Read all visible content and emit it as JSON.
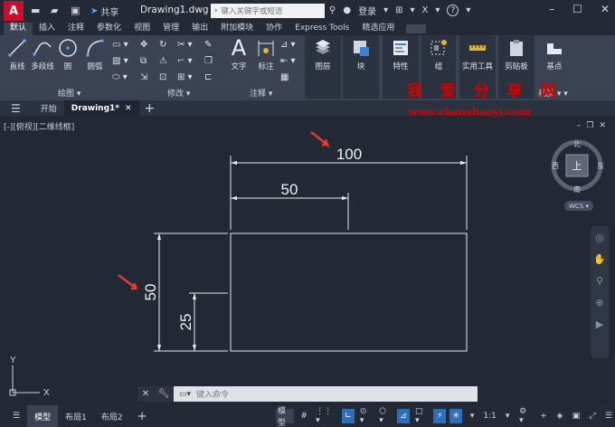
{
  "titlebar": {
    "logo": "A",
    "share_label": "共享",
    "doc_title": "Drawing1.dwg",
    "search_placeholder": "键入关键字或短语",
    "login_label": "登录",
    "help": "?"
  },
  "ribbon_tabs": [
    "默认",
    "插入",
    "注释",
    "参数化",
    "视图",
    "管理",
    "输出",
    "附加模块",
    "协作",
    "Express Tools",
    "精选应用"
  ],
  "ribbon": {
    "draw": {
      "line": "直线",
      "polyline": "多段线",
      "circle": "圆",
      "arc": "圆弧"
    },
    "text": "文字",
    "dimension": "标注",
    "layers": "图层",
    "block": "块",
    "properties": "特性",
    "groups": "组",
    "utilities": "实用工具",
    "clipboard": "剪贴板",
    "basepoint": "基点",
    "panel_labels": {
      "draw": "绘图",
      "modify": "修改",
      "annotation": "注释",
      "view": "视图"
    }
  },
  "doc_tabs": {
    "start": "开始",
    "drawing": "Drawing1*"
  },
  "viewport_label": "[-][俯视][二维线框]",
  "viewcube": {
    "north": "北",
    "south": "南",
    "east": "东",
    "west": "西",
    "top": "上",
    "wcs": "WCS"
  },
  "dimensions": {
    "top_overall": "100",
    "top_partial": "50",
    "left_overall": "50",
    "left_partial": "25"
  },
  "watermark": {
    "line1": "我 爱 分 享 网",
    "line2": "www.zhanshaoyi.com"
  },
  "command": {
    "placeholder": "键入命令"
  },
  "ucs": {
    "x": "X",
    "y": "Y"
  },
  "statusbar": {
    "tabs": [
      "模型",
      "布局1",
      "布局2"
    ],
    "model_label": "模型",
    "scale": "1:1"
  },
  "colors": {
    "accent": "#c8102e",
    "canvas": "#222834",
    "arrow": "#e8392c",
    "watermark": "#d40000"
  }
}
